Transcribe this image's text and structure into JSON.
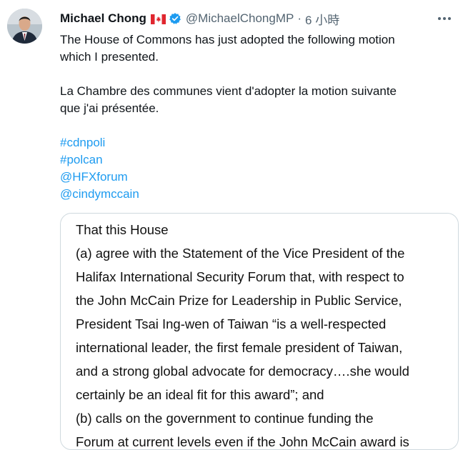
{
  "tweet": {
    "author_name": "Michael Chong",
    "handle": "@MichaelChongMP",
    "separator": "·",
    "time": "6 小時",
    "flag_icon": "canada-flag-icon",
    "verified_icon": "verified-badge-icon",
    "more_icon": "more-options-icon",
    "text_en_line1": "The House of Commons has just adopted the following motion",
    "text_en_line2": "which I presented.",
    "text_fr_line1": "La Chambre des communes vient d'adopter la motion suivante",
    "text_fr_line2": "que j'ai présentée.",
    "hashtags": [
      "#cdnpoli",
      "#polcan"
    ],
    "mentions": [
      "@HFXforum",
      "@cindymccain"
    ]
  },
  "attachment": {
    "lines": [
      "That this House",
      "(a) agree with the Statement of the Vice President of the",
      "Halifax International Security Forum that, with respect to",
      "the John McCain Prize for Leadership in Public Service,",
      "President Tsai Ing-wen of Taiwan “is a well-respected",
      "international leader, the first female president of Taiwan,",
      "and a strong global advocate for democracy….she would",
      "certainly be an ideal fit for this award”; and",
      "(b) calls on the government to continue funding the",
      "Forum at current levels even if the John McCain award is"
    ]
  },
  "colors": {
    "link": "#1d9bf0",
    "secondary_text": "#536471",
    "primary_text": "#0f1419",
    "border": "#cfd9de"
  }
}
